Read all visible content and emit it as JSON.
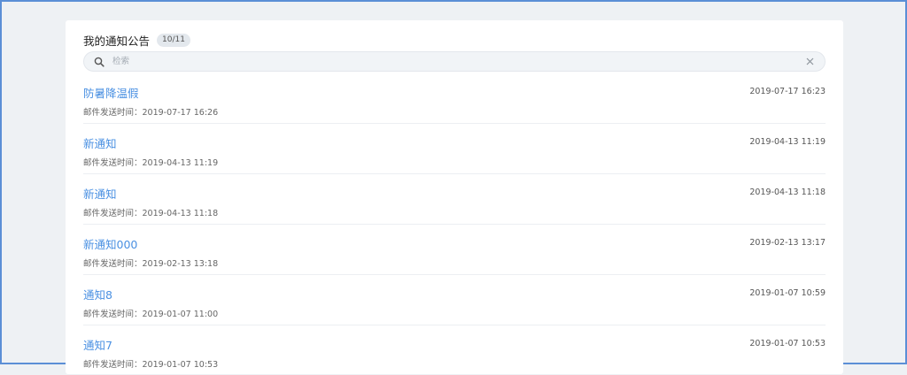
{
  "header": {
    "title": "我的通知公告",
    "count": "10/11"
  },
  "search": {
    "placeholder": "检索",
    "value": ""
  },
  "colors": {
    "accent": "#4a90e2",
    "background": "#eef1f4",
    "card": "#ffffff",
    "frame": "#5b8fd6"
  },
  "notices": [
    {
      "title": "防暑降温假",
      "date": "2019-07-17 16:23",
      "meta": "邮件发送时间：2019-07-17 16:26"
    },
    {
      "title": "新通知",
      "date": "2019-04-13 11:19",
      "meta": "邮件发送时间：2019-04-13 11:19"
    },
    {
      "title": "新通知",
      "date": "2019-04-13 11:18",
      "meta": "邮件发送时间：2019-04-13 11:18"
    },
    {
      "title": "新通知000",
      "date": "2019-02-13 13:17",
      "meta": "邮件发送时间：2019-02-13 13:18"
    },
    {
      "title": "通知8",
      "date": "2019-01-07 10:59",
      "meta": "邮件发送时间：2019-01-07 11:00"
    },
    {
      "title": "通知7",
      "date": "2019-01-07 10:53",
      "meta": "邮件发送时间：2019-01-07 10:53"
    }
  ]
}
